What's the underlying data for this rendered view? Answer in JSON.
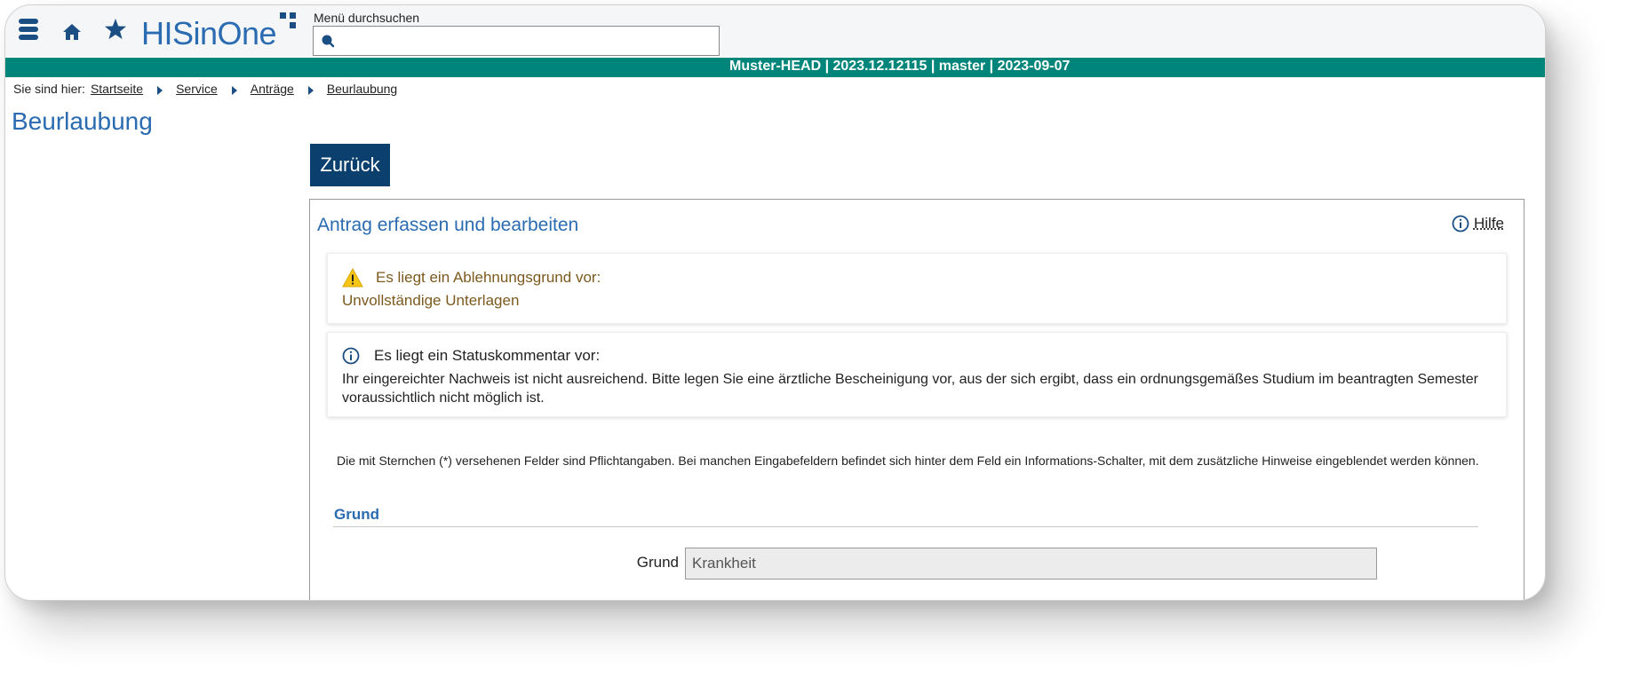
{
  "header": {
    "logo_text": "HISinOne",
    "search": {
      "label": "Menü durchsuchen",
      "value": ""
    }
  },
  "version_bar": {
    "text": "Muster-HEAD | 2023.12.12115 | master | 2023-09-07"
  },
  "breadcrumb": {
    "prefix": "Sie sind hier:",
    "items": [
      "Startseite",
      "Service",
      "Anträge",
      "Beurlaubung"
    ]
  },
  "page": {
    "title": "Beurlaubung",
    "back_label": "Zurück"
  },
  "panel": {
    "title": "Antrag erfassen und bearbeiten",
    "help_label": "Hilfe",
    "warning": {
      "heading": "Es liegt ein Ablehnungsgrund vor:",
      "body": "Unvollständige Unterlagen"
    },
    "info": {
      "heading": "Es liegt ein Statuskommentar vor:",
      "body": "Ihr eingereichter Nachweis ist nicht ausreichend. Bitte legen Sie eine ärztliche Bescheinigung vor, aus der sich ergibt, dass ein ordnungsgemäßes Studium im beantragten Semester voraussichtlich nicht möglich ist."
    },
    "required_note": "Die mit Sternchen (*) versehenen Felder sind Pflichtangaben. Bei manchen Eingabefeldern befindet sich hinter dem Feld ein Informations-Schalter, mit dem zusätzliche Hinweise eingeblendet werden können.",
    "section_title": "Grund",
    "field": {
      "label": "Grund",
      "value": "Krankheit"
    }
  },
  "colors": {
    "brand_blue": "#2a6bb1",
    "dark_blue": "#0b3f6e",
    "teal": "#00857a",
    "warning_text": "#7c5a1e",
    "warning_icon": "#f5c518"
  }
}
